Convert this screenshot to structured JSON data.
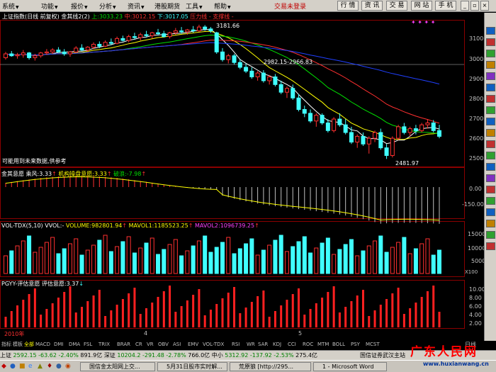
{
  "menu": {
    "items": [
      "系统",
      "功能",
      "报价",
      "分析",
      "资讯",
      "港股期货",
      "工具",
      "帮助"
    ],
    "trade_warning": "交易未登录",
    "buttons": [
      "行 情",
      "资 讯",
      "交 易",
      "网 站",
      "手 机"
    ]
  },
  "chart": {
    "title": "上证指数(日线 前复权) 金其线2(2)",
    "stats": [
      {
        "text": "上:3033.23",
        "color": "#00e000"
      },
      {
        "text": "中:3012.15",
        "color": "#ff3030"
      },
      {
        "text": "下:3017.05",
        "color": "#40ffff"
      },
      {
        "text": "压力线 - 支撑线 -",
        "color": "#ffffff"
      }
    ],
    "annotations": [
      "3181.66",
      "2982.15-2966.83",
      "2481.97"
    ],
    "disclaimer": "可能用到未来数据,供参考",
    "price_axis": [
      "3100",
      "3000",
      "2900",
      "2800",
      "2700",
      "2600",
      "2500"
    ],
    "date_axis": [
      "2010年",
      "4",
      "5"
    ],
    "candles": [
      [
        3010,
        3040,
        3000,
        3030
      ],
      [
        3030,
        3045,
        3015,
        3020
      ],
      [
        3020,
        3035,
        3005,
        3025
      ],
      [
        3025,
        3050,
        3010,
        3035
      ],
      [
        3035,
        3040,
        3000,
        3010
      ],
      [
        3010,
        3030,
        2995,
        3020
      ],
      [
        3020,
        3040,
        3010,
        3035
      ],
      [
        3035,
        3055,
        3025,
        3040
      ],
      [
        3040,
        3060,
        3030,
        3050
      ],
      [
        3050,
        3065,
        3035,
        3040
      ],
      [
        3040,
        3055,
        3020,
        3030
      ],
      [
        3030,
        3045,
        3015,
        3040
      ],
      [
        3040,
        3070,
        3035,
        3060
      ],
      [
        3060,
        3080,
        3045,
        3050
      ],
      [
        3050,
        3070,
        3040,
        3065
      ],
      [
        3065,
        3090,
        3055,
        3080
      ],
      [
        3080,
        3095,
        3060,
        3070
      ],
      [
        3070,
        3100,
        3065,
        3090
      ],
      [
        3090,
        3110,
        3075,
        3085
      ],
      [
        3085,
        3120,
        3080,
        3110
      ],
      [
        3110,
        3125,
        3095,
        3100
      ],
      [
        3100,
        3130,
        3090,
        3120
      ],
      [
        3120,
        3140,
        3105,
        3115
      ],
      [
        3115,
        3140,
        3100,
        3130
      ],
      [
        3130,
        3150,
        3115,
        3125
      ],
      [
        3125,
        3145,
        3110,
        3140
      ],
      [
        3140,
        3160,
        3125,
        3135
      ],
      [
        3135,
        3150,
        3115,
        3120
      ],
      [
        3120,
        3145,
        3110,
        3140
      ],
      [
        3140,
        3165,
        3130,
        3150
      ],
      [
        3150,
        3170,
        3135,
        3145
      ],
      [
        3145,
        3160,
        3130,
        3155
      ],
      [
        3155,
        3175,
        3140,
        3150
      ],
      [
        3150,
        3182,
        3145,
        3170
      ],
      [
        3170,
        3180,
        3150,
        3160
      ],
      [
        3160,
        3170,
        3140,
        3150
      ],
      [
        3140,
        3145,
        3030,
        3040
      ],
      [
        3040,
        3060,
        2990,
        3000
      ],
      [
        3000,
        3030,
        2980,
        3020
      ],
      [
        3020,
        3030,
        2975,
        2985
      ],
      [
        2985,
        3000,
        2950,
        2960
      ],
      [
        2960,
        2980,
        2930,
        2940
      ],
      [
        2940,
        2960,
        2900,
        2910
      ],
      [
        2910,
        2940,
        2890,
        2930
      ],
      [
        2930,
        2945,
        2880,
        2890
      ],
      [
        2890,
        2920,
        2870,
        2910
      ],
      [
        2910,
        2925,
        2860,
        2870
      ],
      [
        2870,
        2890,
        2820,
        2830
      ],
      [
        2830,
        2860,
        2800,
        2850
      ],
      [
        2850,
        2870,
        2790,
        2800
      ],
      [
        2800,
        2820,
        2730,
        2740
      ],
      [
        2740,
        2760,
        2700,
        2720
      ],
      [
        2720,
        2740,
        2670,
        2680
      ],
      [
        2680,
        2720,
        2650,
        2710
      ],
      [
        2710,
        2720,
        2660,
        2670
      ],
      [
        2670,
        2690,
        2620,
        2630
      ],
      [
        2630,
        2700,
        2620,
        2690
      ],
      [
        2690,
        2720,
        2650,
        2660
      ],
      [
        2660,
        2690,
        2610,
        2620
      ],
      [
        2620,
        2650,
        2560,
        2570
      ],
      [
        2570,
        2610,
        2540,
        2600
      ],
      [
        2600,
        2620,
        2550,
        2560
      ],
      [
        2560,
        2600,
        2510,
        2590
      ],
      [
        2590,
        2630,
        2570,
        2620
      ],
      [
        2620,
        2640,
        2530,
        2540
      ],
      [
        2540,
        2560,
        2482,
        2500
      ],
      [
        2500,
        2600,
        2490,
        2590
      ],
      [
        2590,
        2660,
        2580,
        2650
      ],
      [
        2650,
        2670,
        2610,
        2620
      ],
      [
        2620,
        2650,
        2600,
        2640
      ],
      [
        2640,
        2660,
        2610,
        2630
      ],
      [
        2630,
        2670,
        2620,
        2660
      ],
      [
        2660,
        2690,
        2640,
        2670
      ],
      [
        2670,
        2685,
        2620,
        2630
      ],
      [
        2630,
        2660,
        2590,
        2600
      ]
    ],
    "pane2_title": "金其意愿",
    "pane2_items": [
      {
        "text": "乘风:3.33",
        "color": "#ffffff"
      },
      {
        "text": "机构操盘意愿:3.33",
        "color": "#ffff00"
      },
      {
        "text": "破浪:-7.98",
        "color": "#00e000"
      }
    ],
    "pane2_axis": [
      "0.00",
      "-150.00"
    ],
    "pane3_title": "VOL-TDX(5,10)",
    "pane3_items": [
      {
        "text": "VVOL:-",
        "color": "#ffffff"
      },
      {
        "text": "VOLUME:982801.94",
        "color": "#ffff00"
      },
      {
        "text": "MAVOL1:1185523.25",
        "color": "#ffff00"
      },
      {
        "text": "MAVOL2:1096739.25",
        "color": "#ff40ff"
      }
    ],
    "pane3_axis": [
      "15000",
      "10000",
      "5000"
    ],
    "pane3_unit": "X100",
    "pane4_title": "PGYY-评估意愿",
    "pane4_items": [
      {
        "text": "评估意愿:3.37",
        "color": "#ffffff"
      }
    ],
    "pane4_axis": [
      "10.00",
      "8.00",
      "6.00",
      "4.00",
      "2.00"
    ]
  },
  "tabs": [
    "指标",
    "模板",
    "全部",
    "MACD",
    "DMI",
    "DMA",
    "FSL",
    "TRIX",
    "BRAR",
    "CR",
    "VR",
    "OBV",
    "ASI",
    "EMV",
    "VOL-TDX",
    "RSI",
    "WR",
    "SAR",
    "KDJ",
    "CCI",
    "ROC",
    "MTM",
    "BOLL",
    "PSY",
    "MCST"
  ],
  "tab_right": "日线",
  "quote_bar": [
    {
      "text": "上证",
      "color": "#000000"
    },
    {
      "text": "2592.15",
      "color": "#008000"
    },
    {
      "text": "-63.62",
      "color": "#008000"
    },
    {
      "text": "-2.40%",
      "color": "#008000"
    },
    {
      "text": "891.9亿",
      "color": "#000000"
    },
    {
      "text": "深证",
      "color": "#000000"
    },
    {
      "text": "10204.2",
      "color": "#008000"
    },
    {
      "text": "-291.48",
      "color": "#008000"
    },
    {
      "text": "-2.78%",
      "color": "#008000"
    },
    {
      "text": "766.0亿",
      "color": "#000000"
    },
    {
      "text": "中小",
      "color": "#000000"
    },
    {
      "text": "5312.92",
      "color": "#008000"
    },
    {
      "text": "-137.92",
      "color": "#008000"
    },
    {
      "text": "-2.53%",
      "color": "#008000"
    },
    {
      "text": "275.4亿",
      "color": "#000000"
    }
  ],
  "quote_right": "国信证券武汉主站",
  "taskbar": [
    "国信金太阳网上交...",
    "5月31日股市实时解...",
    "荒原狼 [http://295...",
    "1 - Microsoft Word"
  ],
  "watermark": "广东人民网",
  "watermark_url": "www.huxianwang.cn"
}
